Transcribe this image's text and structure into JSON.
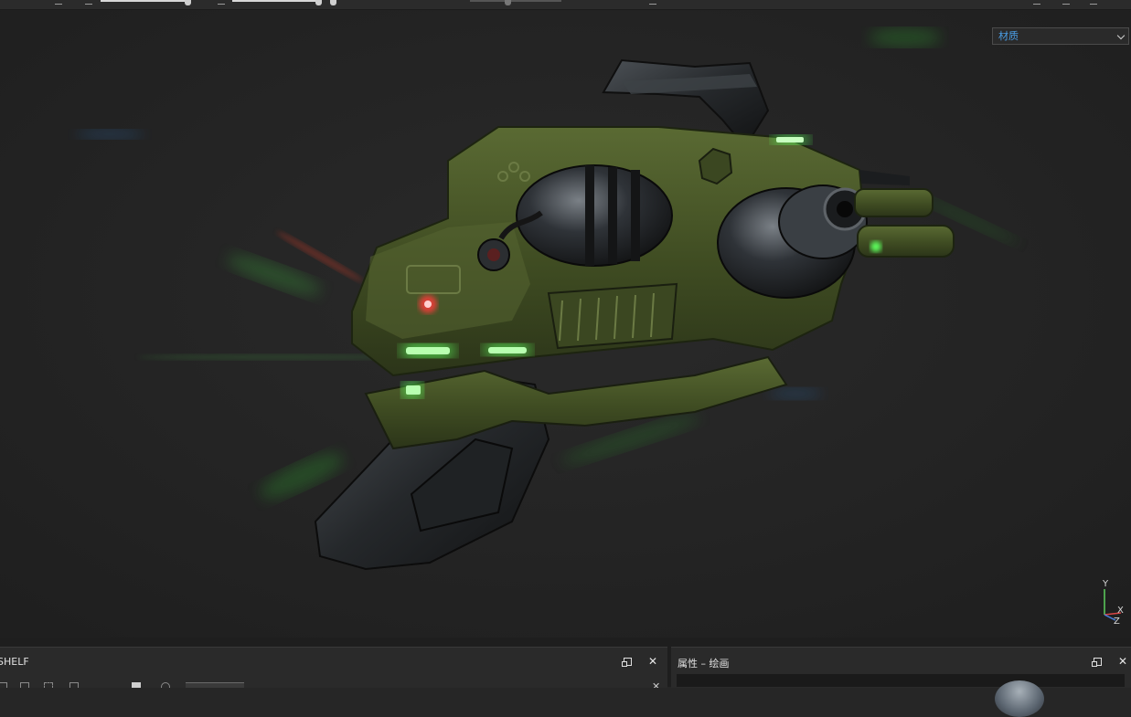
{
  "viewport": {
    "render_mode_select": {
      "value": "材质"
    },
    "axis_labels": {
      "y": "Y",
      "x": "X",
      "z": "Z"
    }
  },
  "panels": {
    "left": {
      "title": "SHELF",
      "tab_label": ""
    },
    "right": {
      "title": "属性 – 绘画"
    }
  },
  "icons": {
    "dropdown": "chevron-down-icon",
    "float": "float-window-icon",
    "close": "close-icon",
    "axis": "axis-gizmo-icon"
  },
  "colors": {
    "background": "#262626",
    "accent_text": "#4a9fe8",
    "glow_green": "#5dff5d",
    "led_red": "#ff3b3b"
  }
}
